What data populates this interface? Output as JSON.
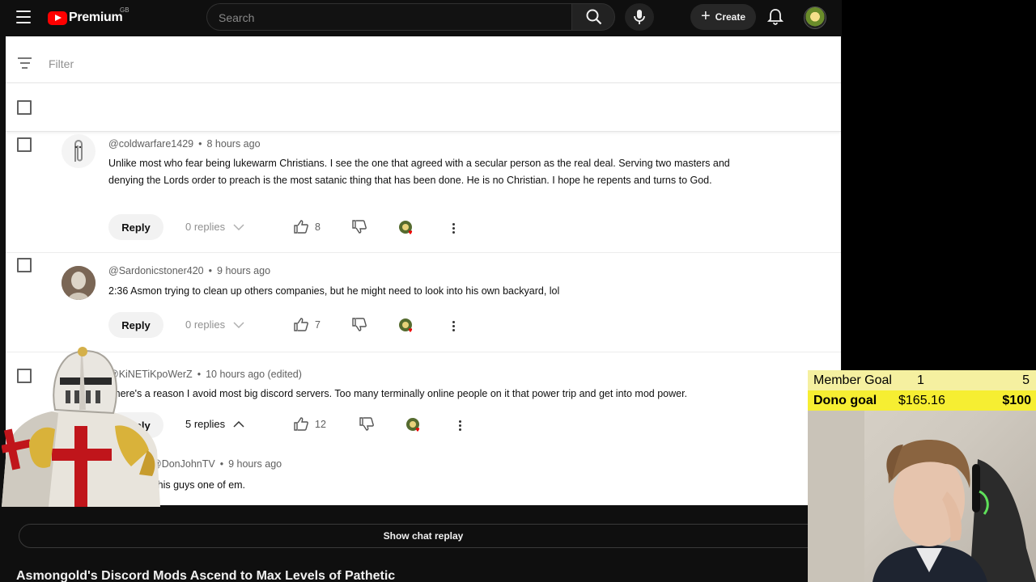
{
  "header": {
    "logo_text": "Premium",
    "country": "GB",
    "search_placeholder": "Search",
    "create_label": "Create"
  },
  "panel": {
    "filter_placeholder": "Filter"
  },
  "comments": [
    {
      "author": "@coldwarfare1429",
      "time": "8 hours ago",
      "text": "Unlike most who fear being lukewarm Christians. I see the one that agreed with a secular person as the real deal. Serving two masters and denying the Lords order to preach is the most satanic thing that has been done. He is no Christian. I hope he repents and turns to God.",
      "reply_label": "Reply",
      "replies": "0 replies",
      "likes": "8"
    },
    {
      "author": "@Sardonicstoner420",
      "time": "9 hours ago",
      "text": "2:36 Asmon trying to clean up others companies, but he might need to look into his own backyard, lol",
      "reply_label": "Reply",
      "replies": "0 replies",
      "likes": "7"
    },
    {
      "author": "@KiNETiKpoWerZ",
      "time": "10 hours ago (edited)",
      "text": "There's a reason I avoid most big  discord servers. Too many terminally online people on it that power trip and get into mod power.",
      "reply_label": "Reply",
      "replies": "5 replies",
      "likes": "12",
      "reply_thread": {
        "author": "@DonJohnTV",
        "time": "9 hours ago",
        "text": "This guys one of em."
      }
    }
  ],
  "bottom": {
    "chat_replay": "Show chat replay",
    "video_title": "Asmongold's Discord Mods Ascend to Max Levels of Pathetic"
  },
  "goals": {
    "member_label": "Member Goal",
    "member_current": "1",
    "member_target": "5",
    "dono_label": "Dono goal",
    "dono_current": "$165.16",
    "dono_target": "$100"
  },
  "colors": {
    "accent_red": "#ff0000",
    "goal_yellow": "#f6ee32"
  }
}
